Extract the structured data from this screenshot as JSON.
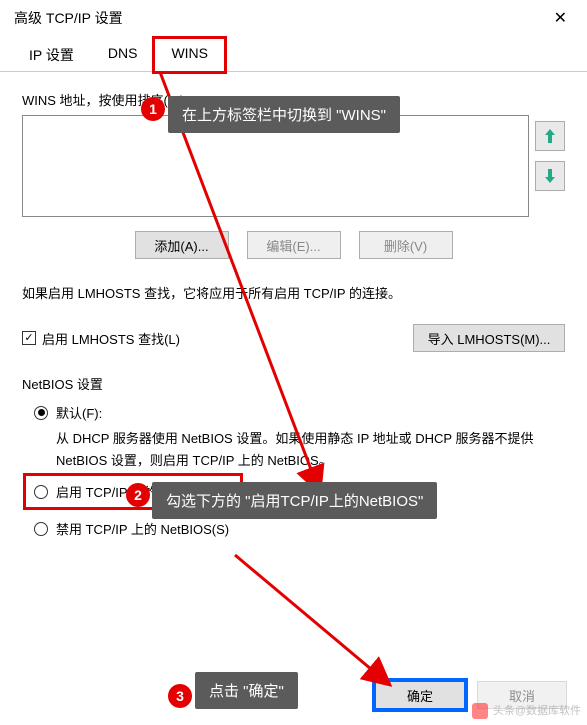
{
  "title": "高级 TCP/IP 设置",
  "tabs": {
    "ip": "IP 设置",
    "dns": "DNS",
    "wins": "WINS"
  },
  "wins_addr_label": "WINS 地址，按使用排序(W):",
  "buttons": {
    "add": "添加(A)...",
    "edit": "编辑(E)...",
    "remove": "删除(V)",
    "import_lmhosts": "导入 LMHOSTS(M)...",
    "ok": "确定",
    "cancel": "取消"
  },
  "lmhosts_note": "如果启用 LMHOSTS 查找，它将应用于所有启用 TCP/IP 的连接。",
  "enable_lmhosts": "启用 LMHOSTS 查找(L)",
  "netbios": {
    "label": "NetBIOS 设置",
    "default": "默认(F):",
    "default_desc": "从 DHCP 服务器使用 NetBIOS 设置。如果使用静态 IP 地址或 DHCP 服务器不提供 NetBIOS 设置，则启用 TCP/IP 上的 NetBIOS。",
    "enable": "启用 TCP/IP 上的 NetBIOS(N)",
    "disable": "禁用 TCP/IP 上的 NetBIOS(S)"
  },
  "callouts": {
    "c1": "在上方标签栏中切换到 \"WINS\"",
    "c2": "勾选下方的 \"启用TCP/IP上的NetBIOS\"",
    "c3": "点击 \"确定\""
  },
  "badges": {
    "b1": "1",
    "b2": "2",
    "b3": "3"
  },
  "watermark": "头条@数据库软件"
}
